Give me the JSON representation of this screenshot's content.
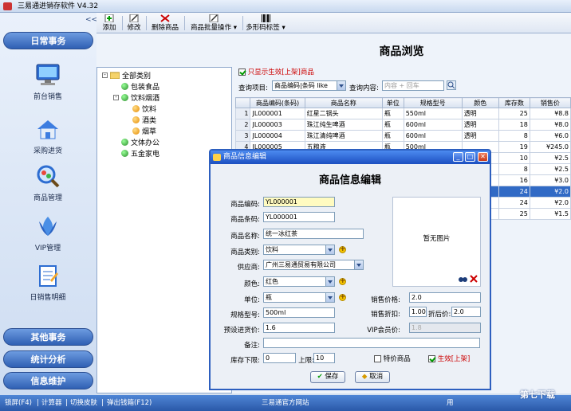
{
  "window": {
    "title": "三易通进销存软件 V4.32"
  },
  "sidebar": {
    "collapse": "<<",
    "sections": {
      "daily": "日常事务",
      "other": "其他事务",
      "stats": "统计分析",
      "info": "信息维护"
    },
    "items": [
      {
        "label": "前台销售",
        "icon": "monitor-icon"
      },
      {
        "label": "采购进货",
        "icon": "house-icon"
      },
      {
        "label": "商品管理",
        "icon": "magnifier-icon"
      },
      {
        "label": "VIP管理",
        "icon": "vip-icon"
      },
      {
        "label": "日销售明细",
        "icon": "notebook-icon"
      }
    ]
  },
  "toolbar": {
    "buttons": [
      "添加",
      "修改",
      "删除商品",
      "商品批量操作",
      "多形码标签"
    ]
  },
  "tree": {
    "root": "全部类别",
    "nodes": [
      "包装食品",
      "饮料烟酒",
      "饮料",
      "酒类",
      "烟草",
      "文体办公",
      "五金家电"
    ]
  },
  "browse": {
    "title": "商品浏览",
    "only_active": "只显示生效[上架]商品",
    "query_label": "查询项目:",
    "query_field": "商品编码|条码 like",
    "content_label": "查询内容:",
    "content_placeholder": "内容 + 回车",
    "columns": [
      "",
      "商品编码(条码)",
      "商品名称",
      "单位",
      "规格型号",
      "颜色",
      "库存数",
      "销售价"
    ],
    "rows": [
      [
        "1",
        "JL000001",
        "红星二锅头",
        "瓶",
        "550ml",
        "透明",
        "25",
        "¥8.8"
      ],
      [
        "2",
        "JL000003",
        "珠江纯生啤酒",
        "瓶",
        "600ml",
        "透明",
        "18",
        "¥8.0"
      ],
      [
        "3",
        "JL000004",
        "珠江清纯啤酒",
        "瓶",
        "600ml",
        "透明",
        "8",
        "¥6.0"
      ],
      [
        "4",
        "JL000005",
        "五粮液",
        "瓶",
        "500ml",
        "",
        "19",
        "¥245.0"
      ],
      [
        "5",
        "",
        "",
        "",
        "",
        "",
        "10",
        "¥2.5"
      ],
      [
        "6",
        "",
        "",
        "",
        "",
        "",
        "8",
        "¥2.5"
      ],
      [
        "7",
        "",
        "",
        "",
        "",
        "",
        "16",
        "¥3.0"
      ],
      [
        "8",
        "",
        "",
        "",
        "",
        "",
        "24",
        "¥2.0"
      ],
      [
        "9",
        "",
        "",
        "",
        "",
        "",
        "24",
        "¥2.0"
      ],
      [
        "10",
        "",
        "",
        "",
        "",
        "",
        "25",
        "¥1.5"
      ]
    ]
  },
  "dialog": {
    "title": "商品信息编辑",
    "heading": "商品信息编辑",
    "fields": {
      "code": {
        "label": "商品编码:",
        "value": "YL000001"
      },
      "barcode": {
        "label": "商品条码:",
        "value": "YL000001"
      },
      "name": {
        "label": "商品名称:",
        "value": "统一冰红茶"
      },
      "category": {
        "label": "商品类别:",
        "value": "饮料"
      },
      "supplier": {
        "label": "供应商:",
        "value": "广州三易通贸易有限公司"
      },
      "color": {
        "label": "颜色:",
        "value": "红色"
      },
      "unit": {
        "label": "单位:",
        "value": "瓶"
      },
      "spec": {
        "label": "规格型号:",
        "value": "500ml"
      },
      "cost": {
        "label": "预设进货价:",
        "value": "1.6"
      },
      "remark": {
        "label": "备注:",
        "value": ""
      },
      "sale_price": {
        "label": "销售价格:",
        "value": "2.0"
      },
      "discount": {
        "label": "销售折扣:",
        "value": "1.00"
      },
      "after_label": "折后价:",
      "after_value": "2.0",
      "vip": {
        "label": "VIP会员价:",
        "value": "1.8"
      },
      "stock_low_label": "库存下限:",
      "stock_low": "0",
      "stock_high_label": "上限:",
      "stock_high": "10",
      "special": "特价商品",
      "active": "生效[上架]"
    },
    "no_image": "暂无图片",
    "save": "保存",
    "cancel": "取消"
  },
  "statusbar": {
    "items": [
      "锁屏(F4)",
      "计算器",
      "切换皮肤",
      "弹出钱箱(F12)"
    ],
    "center": "三易通官方网站",
    "right": "用"
  },
  "watermark": "第七下载"
}
